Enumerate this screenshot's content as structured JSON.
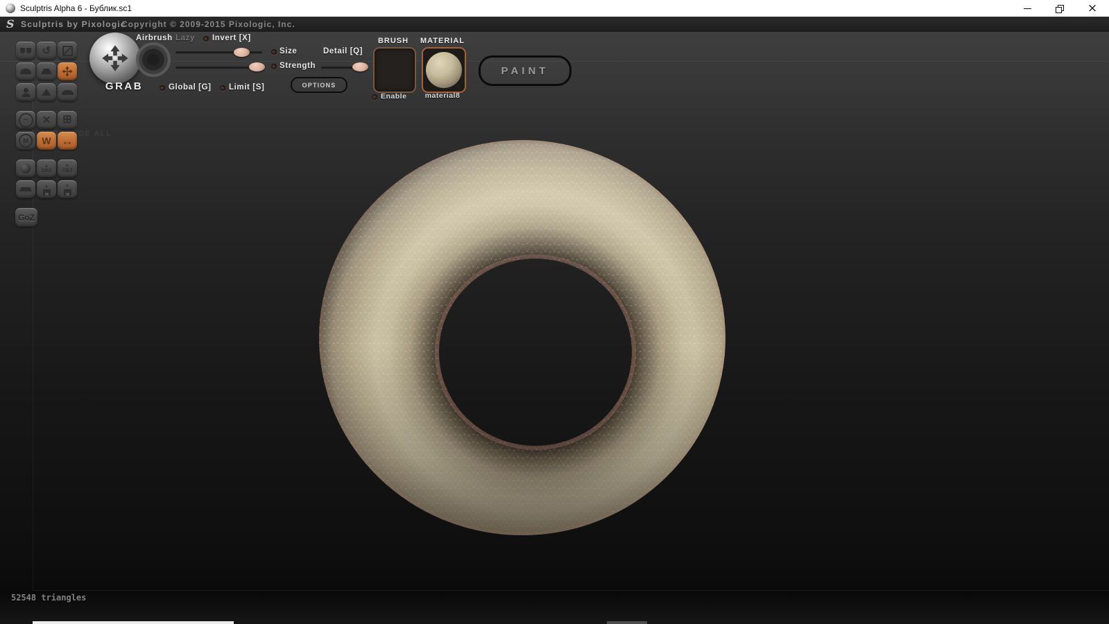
{
  "window": {
    "title": "Sculptris Alpha 6 - Бублик.sc1"
  },
  "menubar": {
    "logo": "S",
    "brand": "Sculptris by Pixologic",
    "copyright": "Copyright © 2009-2015 Pixologic, Inc."
  },
  "toolbar": {
    "tool_name": "GRAB",
    "airbrush_label": "Airbrush",
    "lazy_label": "Lazy",
    "invert_label": "Invert [X]",
    "size_label": "Size",
    "detail_label": "Detail [Q]",
    "strength_label": "Strength",
    "global_label": "Global [G]",
    "limit_label": "Limit [S]",
    "options_label": "OPTIONS",
    "sliders": {
      "size_pct": 76,
      "strength_pct": 94,
      "detail_pct": 85
    },
    "brush": {
      "label": "BRUSH",
      "enable_label": "Enable"
    },
    "material": {
      "label": "MATERIAL",
      "name": "material8"
    },
    "paint_label": "PAINT"
  },
  "sidebar": {
    "tools": [
      {
        "name": "crease"
      },
      {
        "name": "rotate",
        "glyph": "↺"
      },
      {
        "name": "scale"
      },
      {
        "name": "draw"
      },
      {
        "name": "flatten"
      },
      {
        "name": "grab",
        "active": true
      },
      {
        "name": "inflate"
      },
      {
        "name": "pinch"
      },
      {
        "name": "smooth"
      }
    ],
    "mesh": [
      {
        "name": "reduce-brush",
        "glyph": "~"
      },
      {
        "name": "reduce-selected",
        "glyph": "×"
      },
      {
        "name": "subdivide-all",
        "glyph": "⊞"
      },
      {
        "name": "mask",
        "glyph": "M"
      },
      {
        "name": "wireframe",
        "glyph": "W",
        "active": true
      },
      {
        "name": "symmetry",
        "glyph": "↔",
        "active": true
      }
    ],
    "file": [
      {
        "name": "new-sphere"
      },
      {
        "name": "import-obj",
        "text": "OBJ",
        "arrow": "▴"
      },
      {
        "name": "export-obj",
        "text": "OBJ",
        "arrow": "▾"
      },
      {
        "name": "new-plane"
      },
      {
        "name": "open-file",
        "arrow": "▴"
      },
      {
        "name": "save-file",
        "arrow": "▾"
      }
    ],
    "goz_label": "GoZ",
    "faint_tooltip": "SUBDIVIDE ALL"
  },
  "viewport": {
    "status": "52548 triangles",
    "model": "torus"
  },
  "colors": {
    "accent_orange": "#c1763e",
    "material_beige": "#b9ae91",
    "slider_handle": "#dcb6a2",
    "titlebar_bg": "#ffffff",
    "canvas_top": "#3d3d3d",
    "canvas_bottom": "#0b0b0b"
  }
}
